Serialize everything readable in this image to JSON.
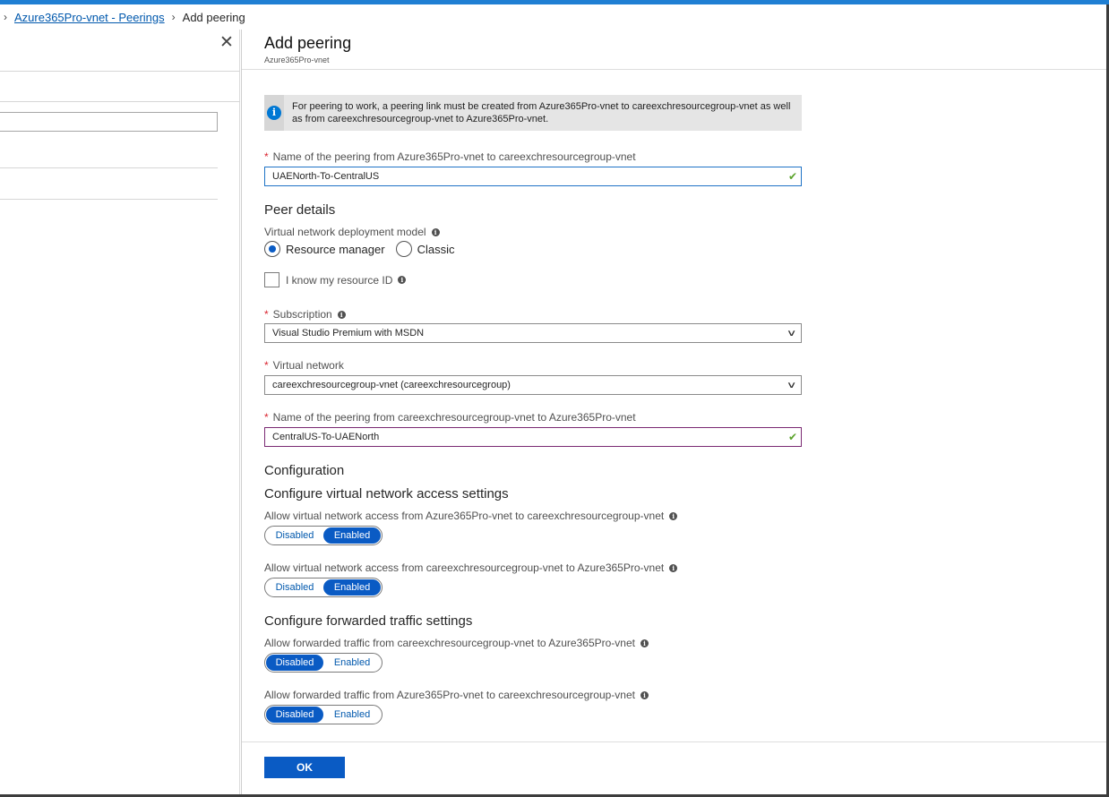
{
  "breadcrumb": {
    "parent": "Azure365Pro-vnet - Peerings",
    "current": "Add peering"
  },
  "panel": {
    "title": "Add peering",
    "subtitle": "Azure365Pro-vnet"
  },
  "info": {
    "text": "For peering to work, a peering link must be created from Azure365Pro-vnet to careexchresourcegroup-vnet as well as from careexchresourcegroup-vnet to Azure365Pro-vnet."
  },
  "peering_name_local": {
    "label": "Name of the peering from Azure365Pro-vnet to careexchresourcegroup-vnet",
    "value": "UAENorth-To-CentralUS"
  },
  "peer_details": {
    "heading": "Peer details",
    "deployment_model_label": "Virtual network deployment model",
    "option_resource_manager": "Resource manager",
    "option_classic": "Classic",
    "selected": "Resource manager",
    "know_resource_id_label": "I know my resource ID",
    "know_resource_id_checked": false
  },
  "subscription": {
    "label": "Subscription",
    "value": "Visual Studio Premium with MSDN"
  },
  "virtual_network": {
    "label": "Virtual network",
    "value": "careexchresourcegroup-vnet (careexchresourcegroup)"
  },
  "peering_name_remote": {
    "label": "Name of the peering from careexchresourcegroup-vnet to Azure365Pro-vnet",
    "value": "CentralUS-To-UAENorth"
  },
  "configuration": {
    "heading": "Configuration",
    "access_heading": "Configure virtual network access settings",
    "access_1_label": "Allow virtual network access from Azure365Pro-vnet to careexchresourcegroup-vnet",
    "access_1_value": "Enabled",
    "access_2_label": "Allow virtual network access from careexchresourcegroup-vnet to Azure365Pro-vnet",
    "access_2_value": "Enabled",
    "forward_heading": "Configure forwarded traffic settings",
    "forward_1_label": "Allow forwarded traffic from careexchresourcegroup-vnet to Azure365Pro-vnet",
    "forward_1_value": "Disabled",
    "forward_2_label": "Allow forwarded traffic from Azure365Pro-vnet to careexchresourcegroup-vnet",
    "forward_2_value": "Disabled",
    "disabled_label": "Disabled",
    "enabled_label": "Enabled"
  },
  "ok_button": "OK",
  "colors": {
    "accent": "#0a5bc4",
    "topbar": "#1f7fd3",
    "required": "#d9232e",
    "valid": "#5ba32b"
  }
}
